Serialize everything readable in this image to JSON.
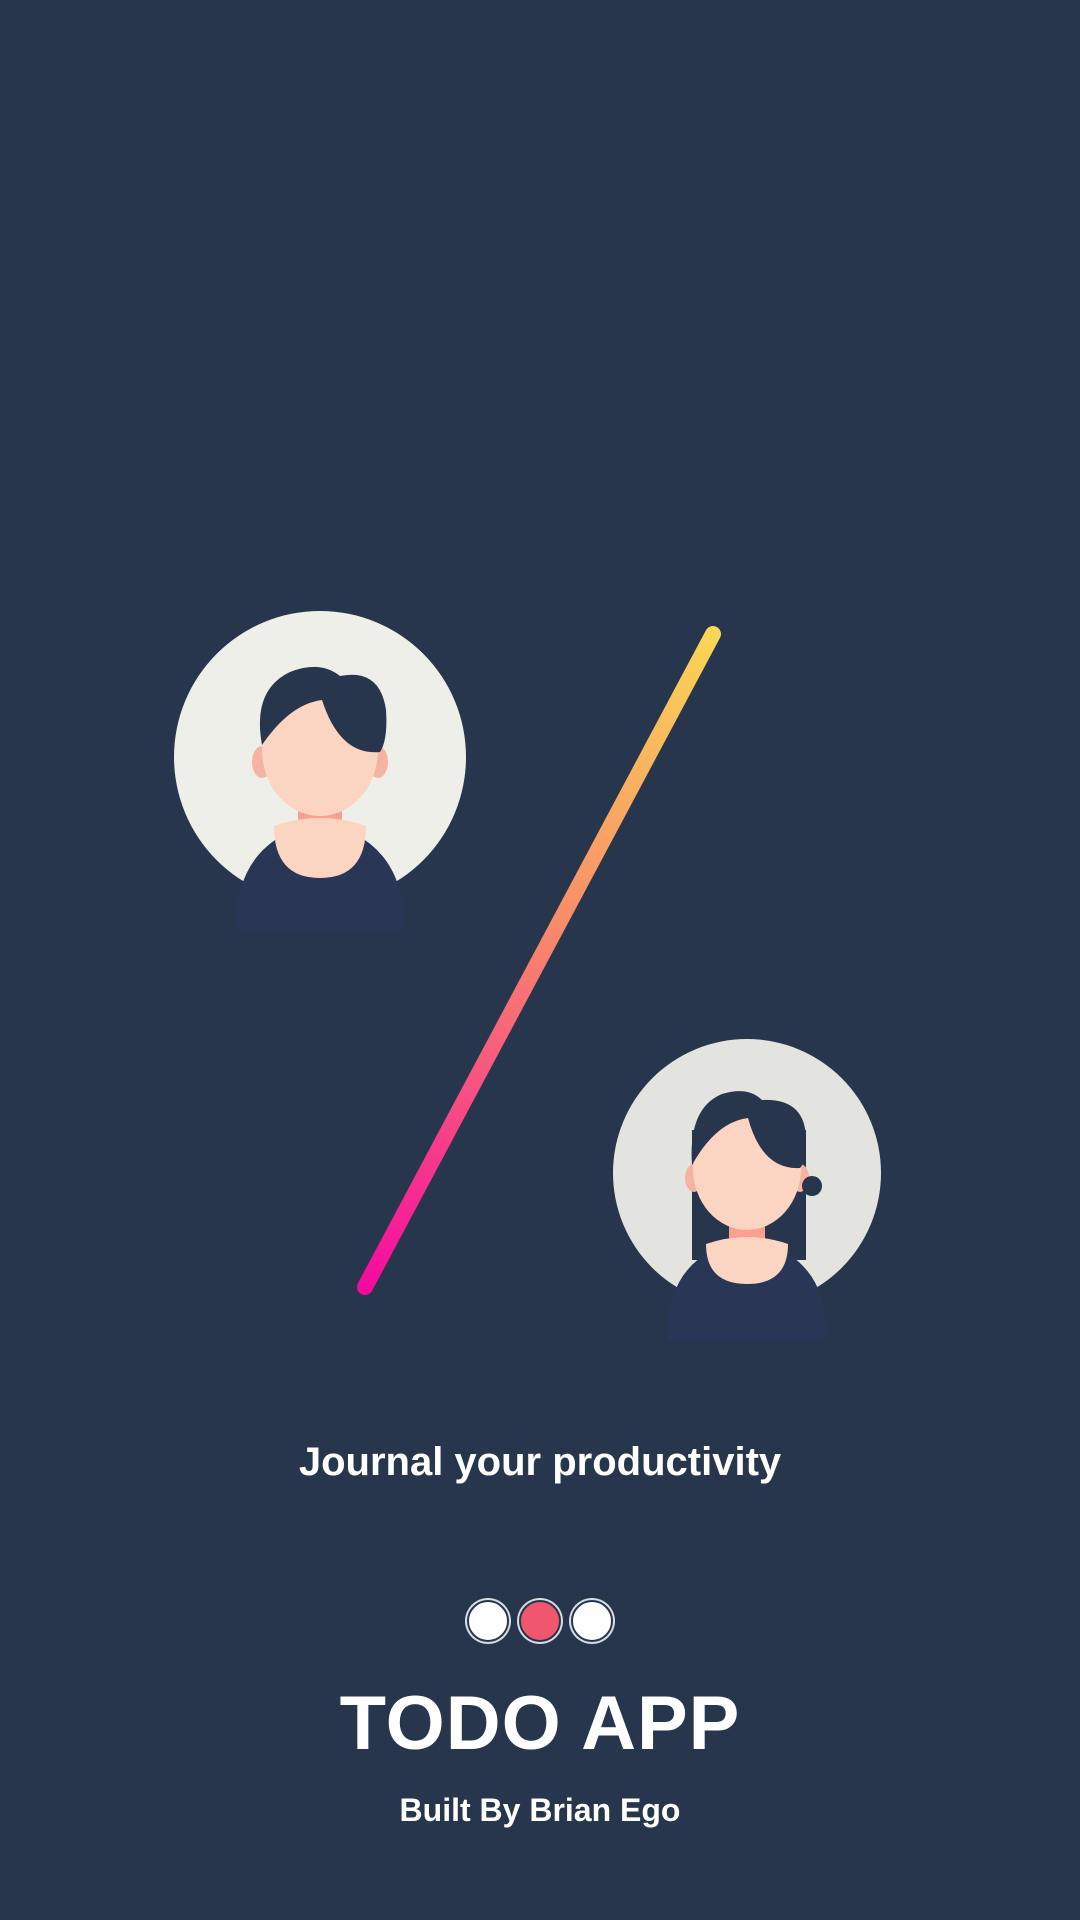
{
  "onboarding": {
    "tagline": "Journal your productivity",
    "app_title": "TODO APP",
    "credit": "Built By Brian Ego",
    "pager": {
      "total_pages": 3,
      "active_index": 1,
      "active_color": "#f0576f",
      "inactive_color": "#ffffff"
    }
  },
  "theme": {
    "background": "#27364c",
    "gradient_start": "#f9d655",
    "gradient_end": "#f50aa0"
  },
  "illustration": {
    "icons": [
      "male-avatar-icon",
      "female-avatar-icon",
      "gradient-slash-line"
    ]
  }
}
